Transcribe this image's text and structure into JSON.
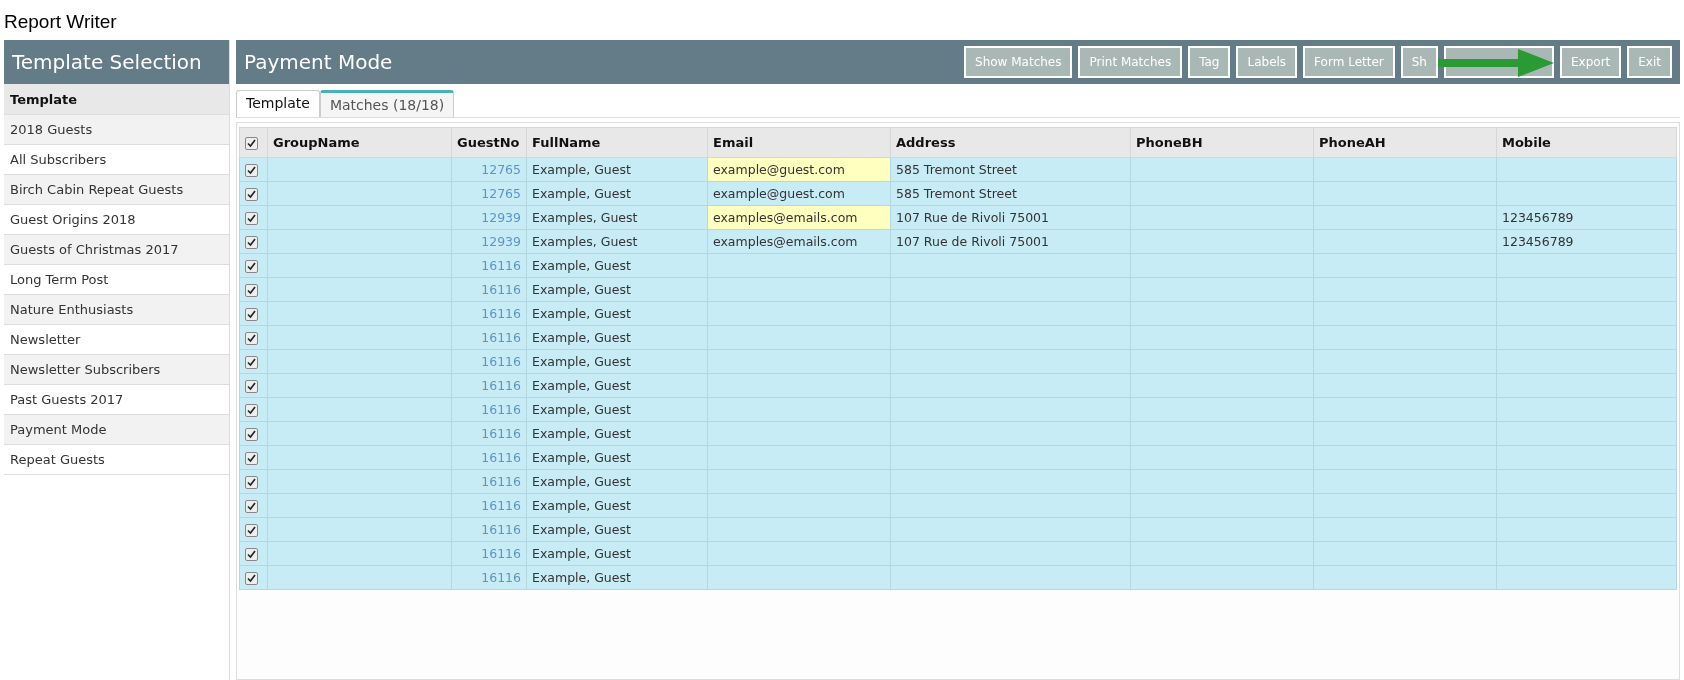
{
  "app_title": "Report Writer",
  "sidebar": {
    "title": "Template Selection",
    "header": "Template",
    "items": [
      {
        "label": "2018 Guests"
      },
      {
        "label": "All Subscribers"
      },
      {
        "label": "Birch Cabin Repeat Guests"
      },
      {
        "label": "Guest Origins 2018"
      },
      {
        "label": "Guests of Christmas 2017"
      },
      {
        "label": "Long Term Post"
      },
      {
        "label": "Nature Enthusiasts"
      },
      {
        "label": "Newsletter"
      },
      {
        "label": "Newsletter Subscribers"
      },
      {
        "label": "Past Guests 2017"
      },
      {
        "label": "Payment Mode"
      },
      {
        "label": "Repeat Guests"
      }
    ]
  },
  "main": {
    "title": "Payment Mode",
    "buttons": [
      {
        "label": "Show Matches"
      },
      {
        "label": "Print Matches"
      },
      {
        "label": "Tag"
      },
      {
        "label": "Labels"
      },
      {
        "label": "Form Letter"
      },
      {
        "label": "Sh",
        "kind": "label"
      },
      {
        "kind": "covered"
      },
      {
        "label": "Export"
      },
      {
        "label": "Exit"
      }
    ],
    "tabs": [
      {
        "label": "Template",
        "selected": false
      },
      {
        "label": "Matches (18/18)",
        "selected": true
      }
    ],
    "table": {
      "all_checked": true,
      "columns": [
        "GroupName",
        "GuestNo",
        "FullName",
        "Email",
        "Address",
        "PhoneBH",
        "PhoneAH",
        "Mobile"
      ],
      "rows": [
        {
          "checked": true,
          "guest_no": "12765",
          "full_name": "Example, Guest",
          "email": "example@guest.com",
          "email_highlighted": true,
          "address": "585 Tremont Street"
        },
        {
          "checked": true,
          "guest_no": "12765",
          "full_name": "Example, Guest",
          "email": "example@guest.com",
          "email_highlighted": false,
          "address": "585 Tremont Street"
        },
        {
          "checked": true,
          "guest_no": "12939",
          "full_name": "Examples, Guest",
          "email": "examples@emails.com",
          "email_highlighted": true,
          "address": "107 Rue de Rivoli 75001",
          "mobile": "123456789"
        },
        {
          "checked": true,
          "guest_no": "12939",
          "full_name": "Examples, Guest",
          "email": "examples@emails.com",
          "email_highlighted": false,
          "address": "107 Rue de Rivoli 75001",
          "mobile": "123456789"
        },
        {
          "checked": true,
          "guest_no": "16116",
          "full_name": "Example, Guest"
        },
        {
          "checked": true,
          "guest_no": "16116",
          "full_name": "Example, Guest"
        },
        {
          "checked": true,
          "guest_no": "16116",
          "full_name": "Example, Guest"
        },
        {
          "checked": true,
          "guest_no": "16116",
          "full_name": "Example, Guest"
        },
        {
          "checked": true,
          "guest_no": "16116",
          "full_name": "Example, Guest"
        },
        {
          "checked": true,
          "guest_no": "16116",
          "full_name": "Example, Guest"
        },
        {
          "checked": true,
          "guest_no": "16116",
          "full_name": "Example, Guest"
        },
        {
          "checked": true,
          "guest_no": "16116",
          "full_name": "Example, Guest"
        },
        {
          "checked": true,
          "guest_no": "16116",
          "full_name": "Example, Guest"
        },
        {
          "checked": true,
          "guest_no": "16116",
          "full_name": "Example, Guest"
        },
        {
          "checked": true,
          "guest_no": "16116",
          "full_name": "Example, Guest"
        },
        {
          "checked": true,
          "guest_no": "16116",
          "full_name": "Example, Guest"
        },
        {
          "checked": true,
          "guest_no": "16116",
          "full_name": "Example, Guest"
        },
        {
          "checked": true,
          "guest_no": "16116",
          "full_name": "Example, Guest"
        }
      ]
    }
  }
}
